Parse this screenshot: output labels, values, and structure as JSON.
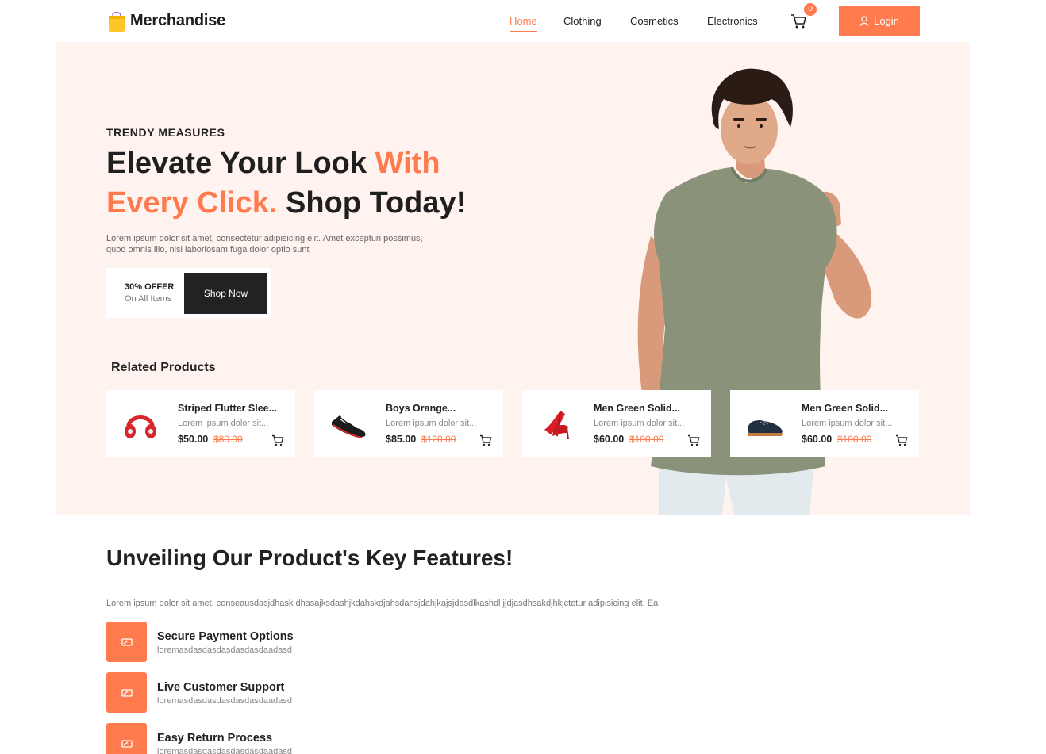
{
  "brand": {
    "name": "Merchandise",
    "logo_icon": "shopping-bag-icon",
    "accent_color": "#ff7a4d"
  },
  "nav": {
    "links": [
      {
        "label": "Home",
        "active": true
      },
      {
        "label": "Clothing",
        "active": false
      },
      {
        "label": "Cosmetics",
        "active": false
      },
      {
        "label": "Electronics",
        "active": false
      }
    ],
    "cart_count": "0",
    "login_label": "Login"
  },
  "hero": {
    "eyebrow": "TRENDY MEASURES",
    "headline_part1": "Elevate Your Look ",
    "headline_accent": "With Every Click.",
    "headline_part2": " Shop Today!",
    "description": "Lorem ipsum dolor sit amet, consectetur adipisicing elit. Amet excepturi possimus, quod omnis illo, nisi laboriosam fuga dolor optio sunt",
    "offer_title": "30% OFFER",
    "offer_sub": "On All Items",
    "cta_label": "Shop Now",
    "background_color": "#fff3f0"
  },
  "related": {
    "title": "Related Products",
    "products": [
      {
        "name": "Striped Flutter Slee...",
        "desc": "Lorem ipsum dolor sit...",
        "price": "$50.00",
        "old_price": "$80.00",
        "icon": "headphones-icon"
      },
      {
        "name": "Boys Orange...",
        "desc": "Lorem ipsum dolor sit...",
        "price": "$85.00",
        "old_price": "$120.00",
        "icon": "sneaker-icon"
      },
      {
        "name": "Men Green Solid...",
        "desc": "Lorem ipsum dolor sit...",
        "price": "$60.00",
        "old_price": "$100.00",
        "icon": "heels-icon"
      },
      {
        "name": "Men Green Solid...",
        "desc": "Lorem ipsum dolor sit...",
        "price": "$60.00",
        "old_price": "$100.00",
        "icon": "shoe-icon"
      }
    ]
  },
  "features": {
    "title": "Unveiling Our Product's Key Features!",
    "description": "Lorem ipsum dolor sit amet, conseausdasjdhask dhasajksdashjkdahskdjahsdahsjdahjkajsjdasdlkashdl jjdjasdhsakdjhkjctetur adipisicing elit. Ea",
    "items": [
      {
        "title": "Secure Payment Options",
        "sub": "loremasdasdasdasdasdasdaadasd"
      },
      {
        "title": "Live Customer Support",
        "sub": "loremasdasdasdasdasdasdaadasd"
      },
      {
        "title": "Easy Return Process",
        "sub": "loremasdasdasdasdasdasdaadasd"
      }
    ]
  }
}
